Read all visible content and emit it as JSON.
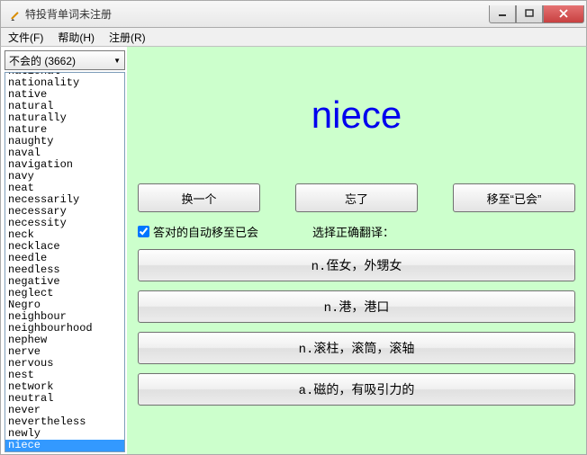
{
  "window": {
    "title": "特投背单词未注册"
  },
  "menu": {
    "file": "文件(F)",
    "help": "帮助(H)",
    "register": "注册(R)"
  },
  "combo": {
    "selected": "不会的 (3662)"
  },
  "words": [
    "national",
    "nationality",
    "native",
    "natural",
    "naturally",
    "nature",
    "naughty",
    "naval",
    "navigation",
    "navy",
    "neat",
    "necessarily",
    "necessary",
    "necessity",
    "neck",
    "necklace",
    "needle",
    "needless",
    "negative",
    "neglect",
    "Negro",
    "neighbour",
    "neighbourhood",
    "nephew",
    "nerve",
    "nervous",
    "nest",
    "network",
    "neutral",
    "never",
    "nevertheless",
    "newly",
    "niece"
  ],
  "selected_word_index": 32,
  "main": {
    "word": "niece",
    "btn_next": "换一个",
    "btn_forget": "忘了",
    "btn_move": "移至“已会”",
    "auto_move_label": "答对的自动移至已会",
    "choose_label": "选择正确翻译：",
    "answers": [
      "n.侄女，外甥女",
      "n.港，港口",
      "n.滚柱，滚筒，滚轴",
      "a.磁的，有吸引力的"
    ]
  }
}
